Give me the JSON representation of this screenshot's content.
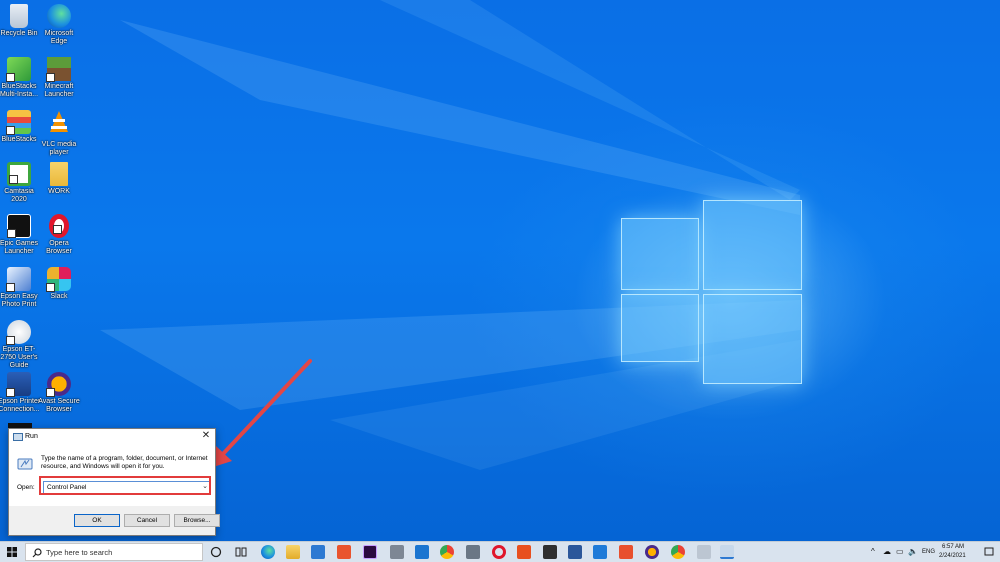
{
  "desktop_icons": [
    {
      "label": "Recycle Bin",
      "icon": "recycle-bin-icon"
    },
    {
      "label": "Microsoft Edge",
      "icon": "edge-icon"
    },
    {
      "label": "BlueStacks Multi-Insta...",
      "icon": "bluestacks-multi-icon"
    },
    {
      "label": "Minecraft Launcher",
      "icon": "minecraft-icon"
    },
    {
      "label": "BlueStacks",
      "icon": "bluestacks-icon"
    },
    {
      "label": "VLC media player",
      "icon": "vlc-icon"
    },
    {
      "label": "Camtasia 2020",
      "icon": "camtasia-icon"
    },
    {
      "label": "WORK",
      "icon": "folder-icon"
    },
    {
      "label": "Epic Games Launcher",
      "icon": "epic-games-icon"
    },
    {
      "label": "Opera Browser",
      "icon": "opera-icon"
    },
    {
      "label": "Epson Easy Photo Print",
      "icon": "epson-photo-icon"
    },
    {
      "label": "Slack",
      "icon": "slack-icon"
    },
    {
      "label": "Epson ET-2750 User's Guide",
      "icon": "epson-guide-icon"
    },
    {
      "label": "Epson Printer Connection...",
      "icon": "epson-connection-icon"
    },
    {
      "label": "Avast Secure Browser",
      "icon": "avast-icon"
    }
  ],
  "run_dialog": {
    "title": "Run",
    "description": "Type the name of a program, folder, document, or Internet resource, and Windows will open it for you.",
    "open_label": "Open:",
    "open_value": "Control Panel",
    "ok_label": "OK",
    "cancel_label": "Cancel",
    "browse_label": "Browse..."
  },
  "taskbar": {
    "search_placeholder": "Type here to search",
    "language": "ENG",
    "time": "6:57 AM",
    "date": "2/24/2021"
  },
  "colors": {
    "desktop": "#0a6fe6",
    "highlight": "#e23b3b",
    "taskbar": "#d9e3ee"
  }
}
